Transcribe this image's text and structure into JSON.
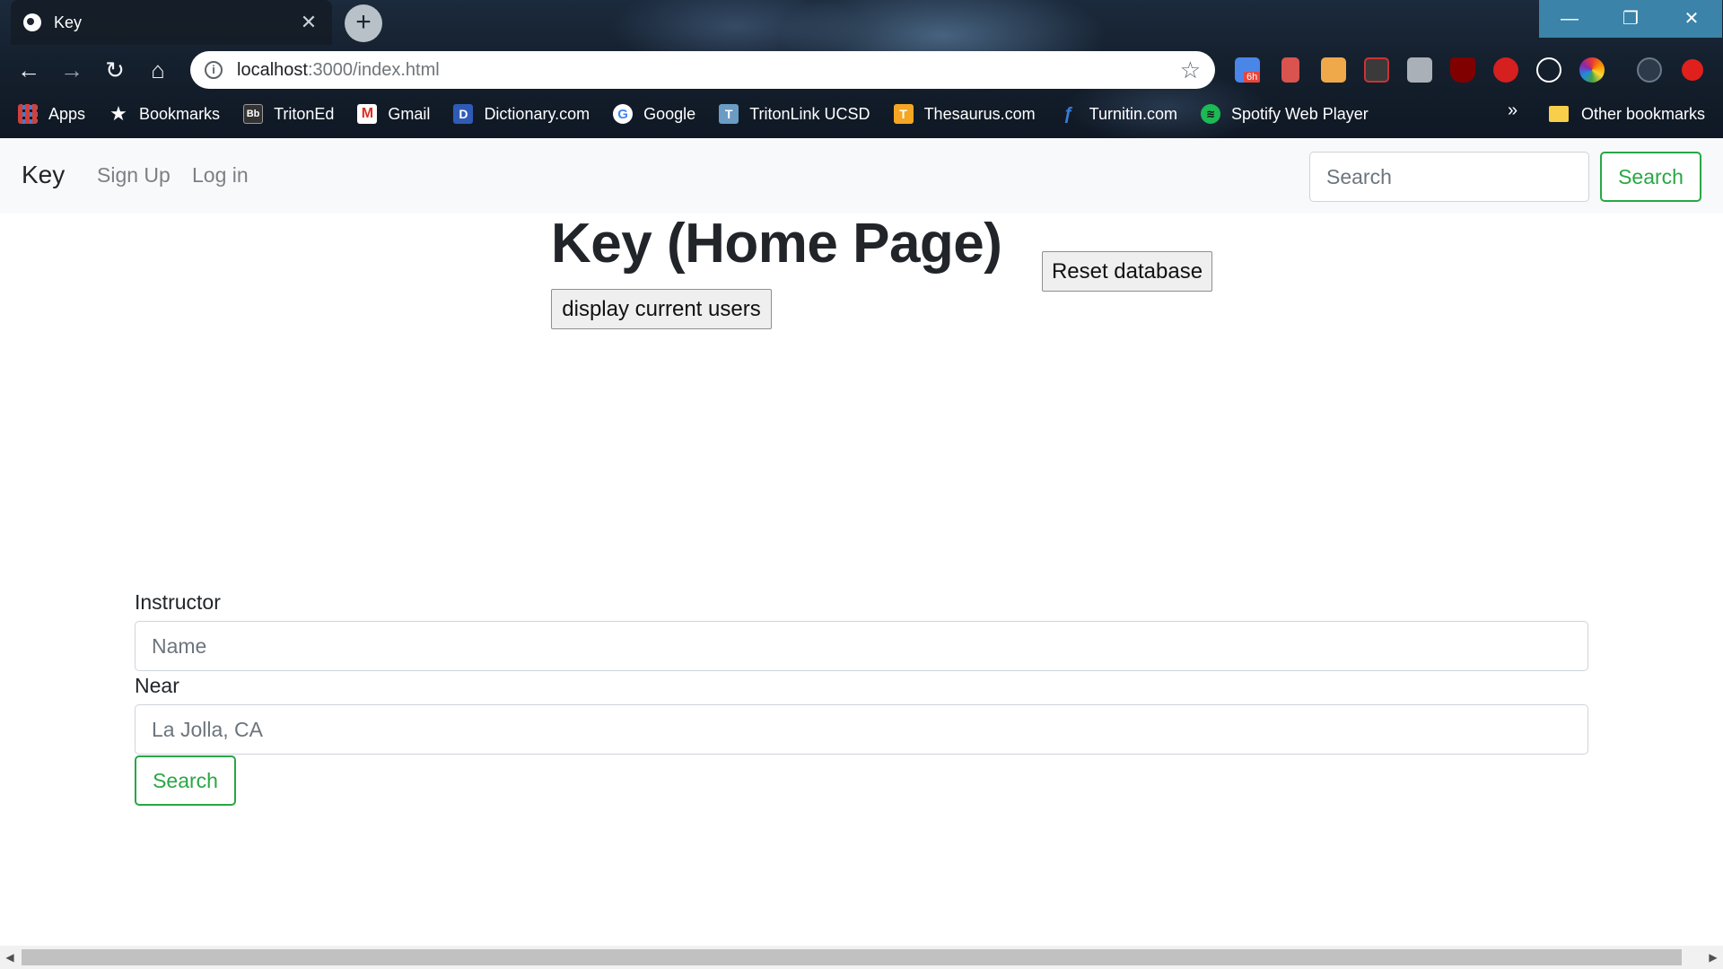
{
  "browser": {
    "tab_title": "Key",
    "tab_close": "✕",
    "new_tab": "+",
    "url_host": "localhost",
    "url_rest": ":3000/index.html",
    "window_controls": {
      "minimize": "—",
      "maximize": "❐",
      "close": "✕"
    },
    "nav": {
      "back": "←",
      "forward": "→",
      "reload": "↻",
      "home": "⌂"
    },
    "star": "☆",
    "info": "i",
    "extension_badge": "6h",
    "bookmarks": [
      {
        "label": "Apps",
        "icon": "apps-grid-icon"
      },
      {
        "label": "Bookmarks",
        "icon": "star-icon"
      },
      {
        "label": "TritonEd",
        "icon": "blackboard-icon"
      },
      {
        "label": "Gmail",
        "icon": "gmail-icon"
      },
      {
        "label": "Dictionary.com",
        "icon": "dictionary-icon"
      },
      {
        "label": "Google",
        "icon": "google-icon"
      },
      {
        "label": "TritonLink UCSD",
        "icon": "tritonlink-icon"
      },
      {
        "label": "Thesaurus.com",
        "icon": "thesaurus-icon"
      },
      {
        "label": "Turnitin.com",
        "icon": "turnitin-icon"
      },
      {
        "label": "Spotify Web Player",
        "icon": "spotify-icon"
      }
    ],
    "bookmarks_more": "»",
    "other_bookmarks": "Other bookmarks"
  },
  "navbar": {
    "brand": "Key",
    "links": [
      "Sign Up",
      "Log in"
    ],
    "search_placeholder": "Search",
    "search_button": "Search"
  },
  "main": {
    "title": "Key (Home Page)",
    "reset_button": "Reset database",
    "display_button": "display current users"
  },
  "form": {
    "instructor_label": "Instructor",
    "instructor_placeholder": "Name",
    "near_label": "Near",
    "near_placeholder": "La Jolla, CA",
    "search_button": "Search"
  },
  "scrollbar": {
    "left_arrow": "◀",
    "right_arrow": "▶"
  },
  "colors": {
    "accent_green": "#28a745",
    "navbar_bg": "#f8f9fa",
    "window_controls": "#3b83a8"
  }
}
